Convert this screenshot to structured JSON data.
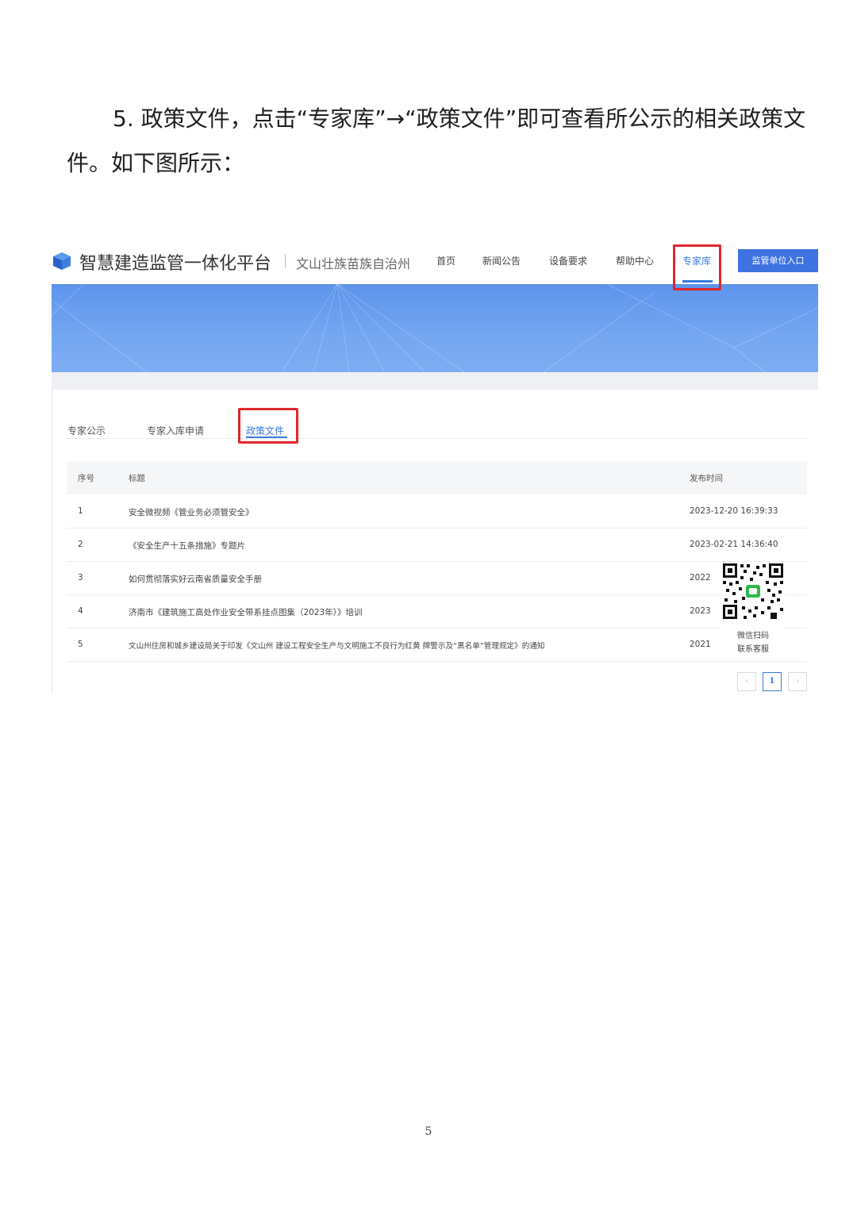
{
  "intro": {
    "number": "5.",
    "text": "政策文件，点击“专家库”→“政策文件”即可查看所公示的相关政策文件。如下图所示："
  },
  "header": {
    "title": "智慧建造监管一体化平台",
    "region": "文山壮族苗族自治州",
    "nav": [
      {
        "label": "首页"
      },
      {
        "label": "新闻公告"
      },
      {
        "label": "设备要求"
      },
      {
        "label": "帮助中心"
      },
      {
        "label": "专家库"
      }
    ],
    "entry_button": "监管单位入口",
    "accent": "#3a7be0",
    "highlight": "#e0262b"
  },
  "tabs": [
    {
      "label": "专家公示"
    },
    {
      "label": "专家入库申请"
    },
    {
      "label": "政策文件"
    }
  ],
  "table": {
    "headers": {
      "index": "序号",
      "title": "标题",
      "date": "发布时间"
    },
    "rows": [
      {
        "index": "1",
        "title": "安全微视频《管业务必须管安全》",
        "date": "2023-12-20 16:39:33"
      },
      {
        "index": "2",
        "title": "《安全生产十五条措施》专题片",
        "date": "2023-02-21 14:36:40"
      },
      {
        "index": "3",
        "title": "如何贯彻落实好云南省质量安全手册",
        "date": "2022"
      },
      {
        "index": "4",
        "title": "济南市《建筑施工高处作业安全带系挂点图集（2023年）》培训",
        "date": "2023"
      },
      {
        "index": "5",
        "title": "文山州住房和城乡建设局关于印发《文山州 建设工程安全生产与文明施工不良行为红黄 牌警示及“黑名单”管理规定》的通知",
        "date": "2021"
      }
    ]
  },
  "qr": {
    "line1": "微信扫码",
    "line2": "联系客服"
  },
  "pagination": {
    "prev": "‹",
    "current": "1",
    "next": "›"
  },
  "page_number": "5"
}
